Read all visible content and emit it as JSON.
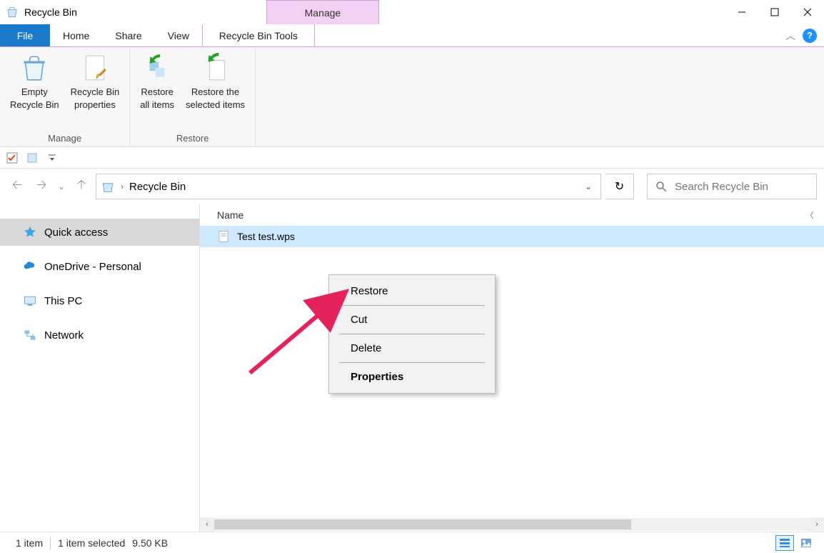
{
  "window": {
    "title": "Recycle Bin"
  },
  "contextualTabHeader": "Manage",
  "tabs": {
    "file": "File",
    "home": "Home",
    "share": "Share",
    "view": "View",
    "contextual": "Recycle Bin Tools"
  },
  "ribbon": {
    "groups": {
      "manage": {
        "label": "Manage",
        "emptyBin": "Empty\nRecycle Bin",
        "properties": "Recycle Bin\nproperties"
      },
      "restore": {
        "label": "Restore",
        "restoreAll": "Restore\nall items",
        "restoreSelected": "Restore the\nselected items"
      }
    }
  },
  "address": {
    "location": "Recycle Bin"
  },
  "search": {
    "placeholder": "Search Recycle Bin"
  },
  "navpane": {
    "quickAccess": "Quick access",
    "onedrive": "OneDrive - Personal",
    "thisPC": "This PC",
    "network": "Network"
  },
  "columns": {
    "name": "Name"
  },
  "files": [
    {
      "name": "Test test.wps"
    }
  ],
  "contextMenu": {
    "restore": "Restore",
    "cut": "Cut",
    "delete": "Delete",
    "properties": "Properties"
  },
  "status": {
    "count": "1 item",
    "selection": "1 item selected",
    "size": "9.50 KB"
  }
}
